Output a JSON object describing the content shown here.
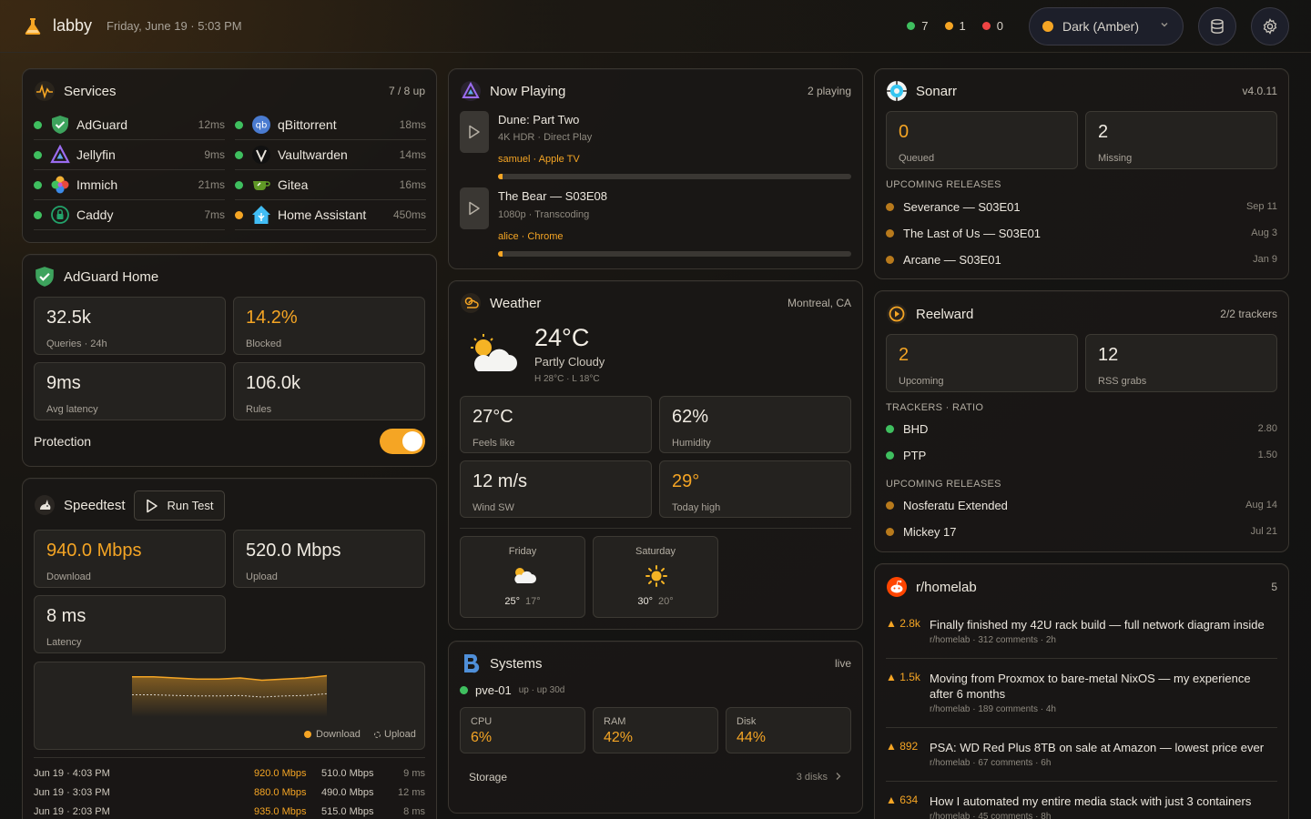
{
  "app": {
    "name": "labby",
    "datetime": "Friday, June 19 · 5:03 PM"
  },
  "header": {
    "status_up": "7",
    "status_warn": "1",
    "status_down": "0",
    "theme_label": "Dark (Amber)"
  },
  "services": {
    "title": "Services",
    "meta": "7 / 8 up",
    "left": [
      {
        "name": "AdGuard",
        "ms": "12ms",
        "status": "up"
      },
      {
        "name": "Jellyfin",
        "ms": "9ms",
        "status": "up"
      },
      {
        "name": "Immich",
        "ms": "21ms",
        "status": "up"
      },
      {
        "name": "Caddy",
        "ms": "7ms",
        "status": "up"
      }
    ],
    "right": [
      {
        "name": "qBittorrent",
        "ms": "18ms",
        "status": "up"
      },
      {
        "name": "Vaultwarden",
        "ms": "14ms",
        "status": "up"
      },
      {
        "name": "Gitea",
        "ms": "16ms",
        "status": "up"
      },
      {
        "name": "Home Assistant",
        "ms": "450ms",
        "status": "warn"
      }
    ]
  },
  "adguard": {
    "title": "AdGuard Home",
    "tiles": [
      {
        "value": "32.5k",
        "label": "Queries · 24h"
      },
      {
        "value": "14.2%",
        "label": "Blocked"
      },
      {
        "value": "9ms",
        "label": "Avg latency"
      },
      {
        "value": "106.0k",
        "label": "Rules"
      }
    ],
    "protection_label": "Protection",
    "protection_on": true
  },
  "speedtest": {
    "title": "Speedtest",
    "run_label": "Run Test",
    "download": {
      "value": "940.0 Mbps",
      "label": "Download"
    },
    "upload": {
      "value": "520.0 Mbps",
      "label": "Upload"
    },
    "latency": {
      "value": "8 ms",
      "label": "Latency"
    },
    "legend_download": "Download",
    "legend_upload": "Upload",
    "history": [
      {
        "time": "Jun 19 · 4:03 PM",
        "down": "920.0 Mbps",
        "up": "510.0 Mbps",
        "lat": "9 ms"
      },
      {
        "time": "Jun 19 · 3:03 PM",
        "down": "880.0 Mbps",
        "up": "490.0 Mbps",
        "lat": "12 ms"
      },
      {
        "time": "Jun 19 · 2:03 PM",
        "down": "935.0 Mbps",
        "up": "515.0 Mbps",
        "lat": "8 ms"
      }
    ]
  },
  "chart_data": {
    "type": "area",
    "title": "",
    "xlabel": "",
    "ylabel": "",
    "series": [
      {
        "name": "Download",
        "values": [
          935,
          935,
          930,
          925,
          925,
          930,
          920,
          925,
          930,
          940
        ]
      },
      {
        "name": "Upload",
        "values": [
          515,
          515,
          512,
          510,
          510,
          512,
          505,
          510,
          512,
          520
        ]
      }
    ],
    "ylim": [
      0,
      1150
    ],
    "legend": "bottom-right"
  },
  "now_playing": {
    "title": "Now Playing",
    "meta": "2 playing",
    "items": [
      {
        "title": "Dune: Part Two",
        "detail": "4K HDR · Direct Play",
        "user": "samuel · Apple TV",
        "progress": 0.006
      },
      {
        "title": "The Bear — S03E08",
        "detail": "1080p · Transcoding",
        "user": "alice · Chrome",
        "progress": 0.006
      }
    ]
  },
  "weather": {
    "title": "Weather",
    "location": "Montreal, CA",
    "temp": "24°C",
    "condition": "Partly Cloudy",
    "hilo": "H 28°C · L 18°C",
    "tiles": [
      {
        "value": "27°C",
        "label": "Feels like"
      },
      {
        "value": "62%",
        "label": "Humidity"
      },
      {
        "value": "12 m/s",
        "label": "Wind SW"
      },
      {
        "value": "29°",
        "label": "Today high"
      }
    ],
    "forecast": [
      {
        "day": "Friday",
        "icon": "partly-cloudy-icon",
        "hi": "25°",
        "lo": "17°"
      },
      {
        "day": "Saturday",
        "icon": "sun-icon",
        "hi": "30°",
        "lo": "20°"
      }
    ]
  },
  "systems": {
    "title": "Systems",
    "meta": "live",
    "host": "pve-01",
    "uptime": "up · up 30d",
    "cpu_label": "CPU",
    "cpu": "6%",
    "ram_label": "RAM",
    "ram": "42%",
    "disk_label": "Disk",
    "disk": "44%",
    "storage_label": "Storage",
    "storage_meta": "3 disks"
  },
  "sonarr": {
    "title": "Sonarr",
    "version": "v4.0.11",
    "queued": {
      "value": "0",
      "label": "Queued"
    },
    "missing": {
      "value": "2",
      "label": "Missing"
    },
    "upcoming_label": "UPCOMING RELEASES",
    "upcoming": [
      {
        "name": "Severance — S03E01",
        "date": "Sep 11"
      },
      {
        "name": "The Last of Us — S03E01",
        "date": "Aug 3"
      },
      {
        "name": "Arcane — S03E01",
        "date": "Jan 9"
      }
    ]
  },
  "reelward": {
    "title": "Reelward",
    "meta": "2/2 trackers",
    "upcoming": {
      "value": "2",
      "label": "Upcoming"
    },
    "rss": {
      "value": "12",
      "label": "RSS grabs"
    },
    "trackers_label": "TRACKERS · RATIO",
    "trackers": [
      {
        "name": "BHD",
        "ratio": "2.80"
      },
      {
        "name": "PTP",
        "ratio": "1.50"
      }
    ],
    "upcoming_label": "UPCOMING RELEASES",
    "releases": [
      {
        "name": "Nosferatu Extended",
        "date": "Aug 14"
      },
      {
        "name": "Mickey 17",
        "date": "Jul 21"
      }
    ]
  },
  "reddit": {
    "title": "r/homelab",
    "count": "5",
    "posts": [
      {
        "score": "▲ 2.8k",
        "title": "Finally finished my 42U rack build — full network diagram inside",
        "meta": "r/homelab · 312 comments · 2h"
      },
      {
        "score": "▲ 1.5k",
        "title": "Moving from Proxmox to bare-metal NixOS — my experience after 6 months",
        "meta": "r/homelab · 189 comments · 4h"
      },
      {
        "score": "▲ 892",
        "title": "PSA: WD Red Plus 8TB on sale at Amazon — lowest price ever",
        "meta": "r/homelab · 67 comments · 6h"
      },
      {
        "score": "▲ 634",
        "title": "How I automated my entire media stack with just 3 containers",
        "meta": "r/homelab · 45 comments · 8h"
      }
    ]
  }
}
